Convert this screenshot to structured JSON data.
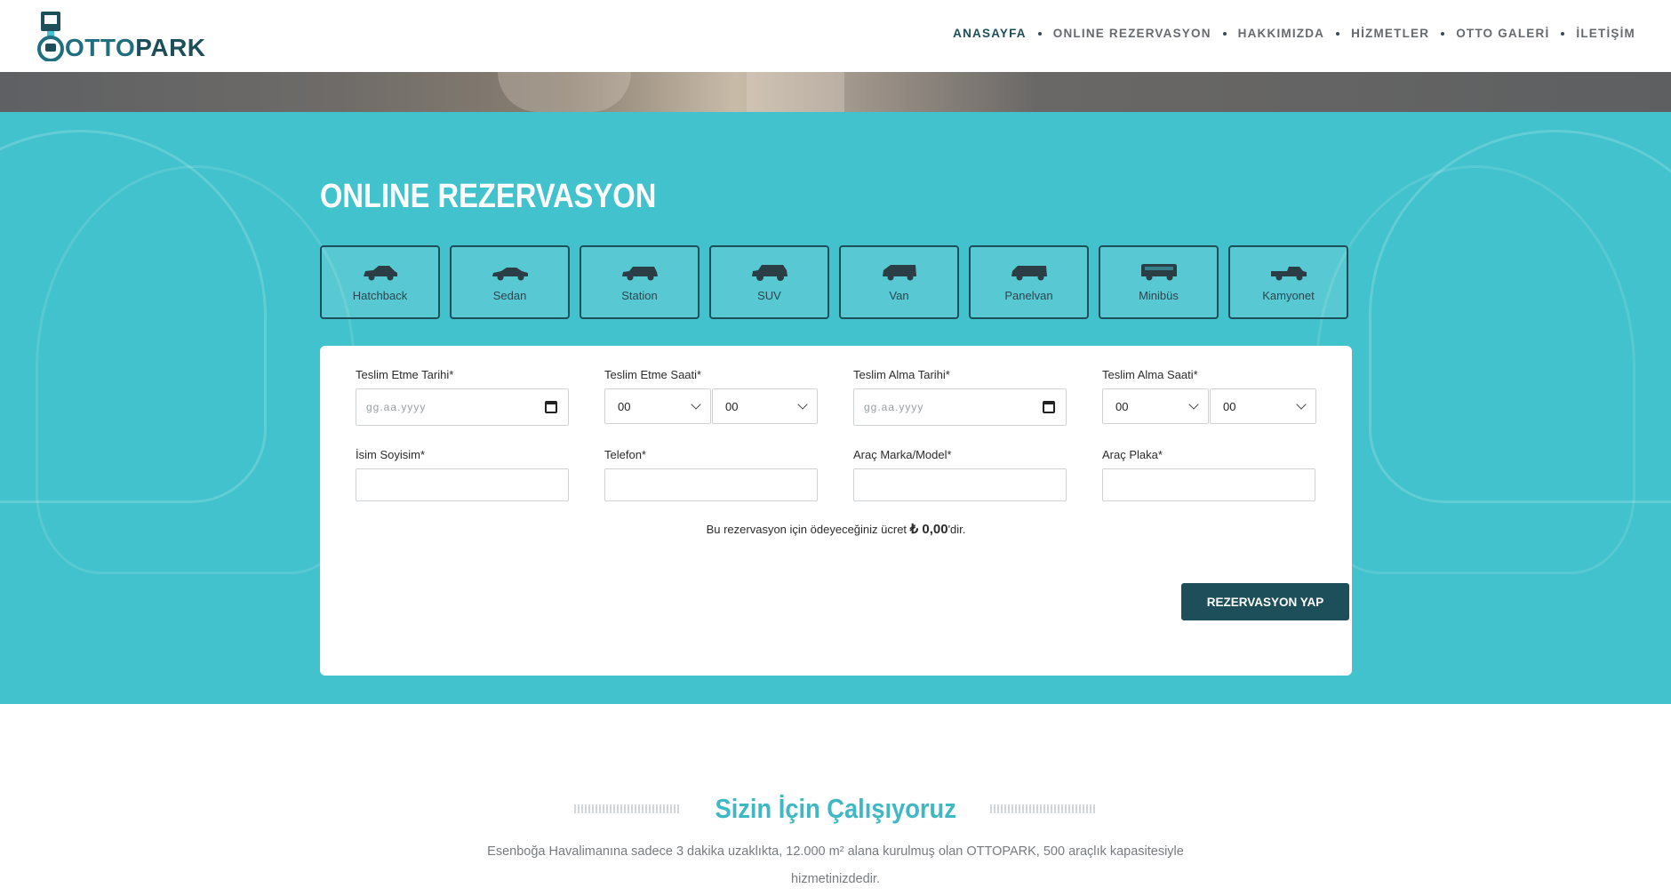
{
  "header": {
    "logo": {
      "text_a": "OTTO",
      "text_b": "PARK"
    },
    "nav": [
      {
        "label": "ANASAYFA",
        "active": true
      },
      {
        "label": "ONLINE REZERVASYON",
        "active": false
      },
      {
        "label": "HAKKIMIZDA",
        "active": false
      },
      {
        "label": "HİZMETLER",
        "active": false
      },
      {
        "label": "OTTO GALERİ",
        "active": false
      },
      {
        "label": "İLETİŞİM",
        "active": false
      }
    ]
  },
  "reservation": {
    "title": "ONLINE REZERVASYON",
    "vehicle_types": [
      {
        "label": "Hatchback",
        "icon": "hatchback-car-icon"
      },
      {
        "label": "Sedan",
        "icon": "sedan-car-icon"
      },
      {
        "label": "Station",
        "icon": "station-car-icon"
      },
      {
        "label": "SUV",
        "icon": "suv-car-icon"
      },
      {
        "label": "Van",
        "icon": "van-car-icon"
      },
      {
        "label": "Panelvan",
        "icon": "panelvan-car-icon"
      },
      {
        "label": "Minibüs",
        "icon": "minibus-car-icon"
      },
      {
        "label": "Kamyonet",
        "icon": "pickup-truck-icon"
      }
    ],
    "form": {
      "delivery_date_label": "Teslim Etme Tarihi*",
      "delivery_date_placeholder": "gg.aa.yyyy",
      "delivery_time_label": "Teslim Etme Saati*",
      "delivery_hour": "00",
      "delivery_minute": "00",
      "pickup_date_label": "Teslim Alma Tarihi*",
      "pickup_date_placeholder": "gg.aa.yyyy",
      "pickup_time_label": "Teslim Alma Saati*",
      "pickup_hour": "00",
      "pickup_minute": "00",
      "name_label": "İsim Soyisim*",
      "name_value": "",
      "phone_label": "Telefon*",
      "phone_value": "",
      "model_label": "Araç Marka/Model*",
      "model_value": "",
      "plate_label": "Araç Plaka*",
      "plate_value": ""
    },
    "price": {
      "prefix": "Bu rezervasyon için ödeyeceğiniz ücret ",
      "amount": "₺ 0,00",
      "suffix": "'dir."
    },
    "submit_label": "REZERVASYON YAP"
  },
  "about": {
    "title": "Sizin İçin Çalışıyoruz",
    "text": "Esenboğa Havalimanına sadece 3 dakika uzaklıkta, 12.000 m² alana kurulmuş olan OTTOPARK, 500 araçlık kapasitesiyle hizmetinizdedir."
  },
  "colors": {
    "brand_teal": "#41c2cc",
    "brand_dark": "#1d4f5b",
    "accent_title": "#3fb8c3"
  }
}
